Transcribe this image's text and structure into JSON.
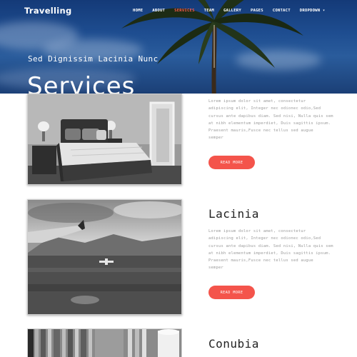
{
  "header": {
    "brand": "Travelling",
    "nav": [
      {
        "label": "HOME"
      },
      {
        "label": "ABOUT"
      },
      {
        "label": "SERVICES"
      },
      {
        "label": "TEAM"
      },
      {
        "label": "GALLERY"
      },
      {
        "label": "PAGES"
      },
      {
        "label": "CONTACT"
      },
      {
        "label": "DROPDOWN ▾"
      }
    ],
    "active_nav": "SERVICES"
  },
  "hero": {
    "subtitle": "Sed Dignissim Lacinia Nunc",
    "title": "Services"
  },
  "services": [
    {
      "title": "",
      "image": "bedroom-photo",
      "lines": [
        "Lorem ipsum dolor sit amet, consectetur",
        "adipiscing elit, Integer nec odionec odio,Sed",
        "cursus ante dapibus diam. Sed nisi, Nulla quis sem",
        "at nibh elementum imperdiet, Duis sagittis ipsum.",
        "Praesent mauris,Fusce nec tellus sed augue",
        "semper"
      ],
      "button": "READ MORE"
    },
    {
      "title": "Lacinia",
      "image": "airplane-photo",
      "lines": [
        "Lorem ipsum dolor sit amet, consectetur",
        "adipiscing elit, Integer nec odionec odio,Sed",
        "cursus ante dapibus diam. Sed nisi, Nulla quis sem",
        "at nibh elementum imperdiet, Duis sagittis ipsum.",
        "Praesent mauris,Fusce nec tellus sed augue",
        "semper"
      ],
      "button": "READ MORE"
    },
    {
      "title": "Conubia",
      "image": "curtain-photo"
    }
  ],
  "colors": {
    "accent": "#f4544b",
    "hero_sky": "#1e4d90",
    "body_text": "#9a9a9a",
    "heading_text": "#222222"
  }
}
